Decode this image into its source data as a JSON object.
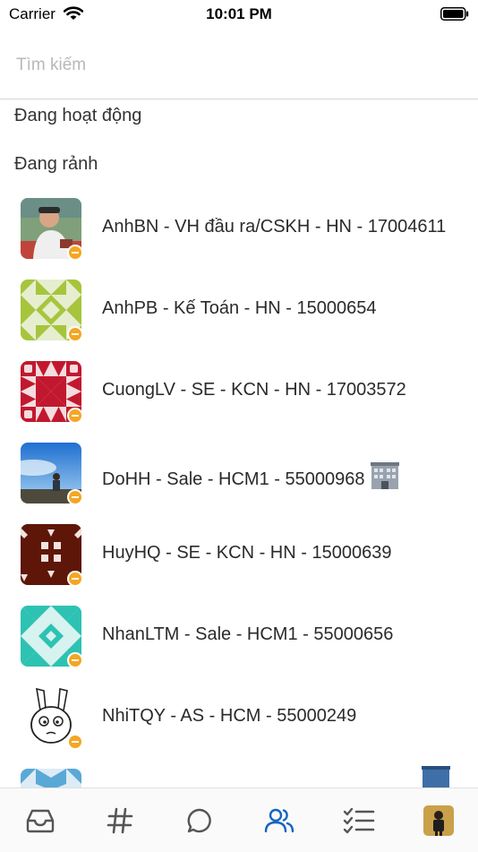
{
  "status_bar": {
    "carrier": "Carrier",
    "time": "10:01 PM"
  },
  "search": {
    "placeholder": "Tìm kiếm",
    "value": ""
  },
  "sections": {
    "active": "Đang hoạt động",
    "idle": "Đang rảnh"
  },
  "contacts": [
    {
      "name": "AnhBN - VH đầu ra/CSKH - HN - 17004611",
      "avatar": "photo-avatar",
      "status": "idle"
    },
    {
      "name": "AnhPB - Kế Toán - HN - 15000654",
      "avatar": "identicon-avatar",
      "status": "idle"
    },
    {
      "name": "CuongLV - SE - KCN - HN - 17003572",
      "avatar": "identicon-avatar",
      "status": "idle"
    },
    {
      "name": "DoHH - Sale - HCM1 - 55000968",
      "avatar": "photo-avatar",
      "status": "idle",
      "trailing_icon": "office-building-icon"
    },
    {
      "name": "HuyHQ - SE - KCN - HN - 15000639",
      "avatar": "identicon-avatar",
      "status": "idle"
    },
    {
      "name": "NhanLTM - Sale - HCM1 - 55000656",
      "avatar": "identicon-avatar",
      "status": "idle"
    },
    {
      "name": "NhiTQY - AS - HCM - 55000249",
      "avatar": "cartoon-avatar",
      "status": "idle"
    }
  ],
  "tab_bar": {
    "items": [
      "inbox-icon",
      "hashtag-icon",
      "chat-bubble-icon",
      "contacts-icon",
      "checklist-icon",
      "profile-avatar"
    ],
    "active": "contacts-icon"
  },
  "colors": {
    "accent": "#1565c0",
    "idle_status": "#f5a623",
    "tab_inactive": "#555555"
  }
}
